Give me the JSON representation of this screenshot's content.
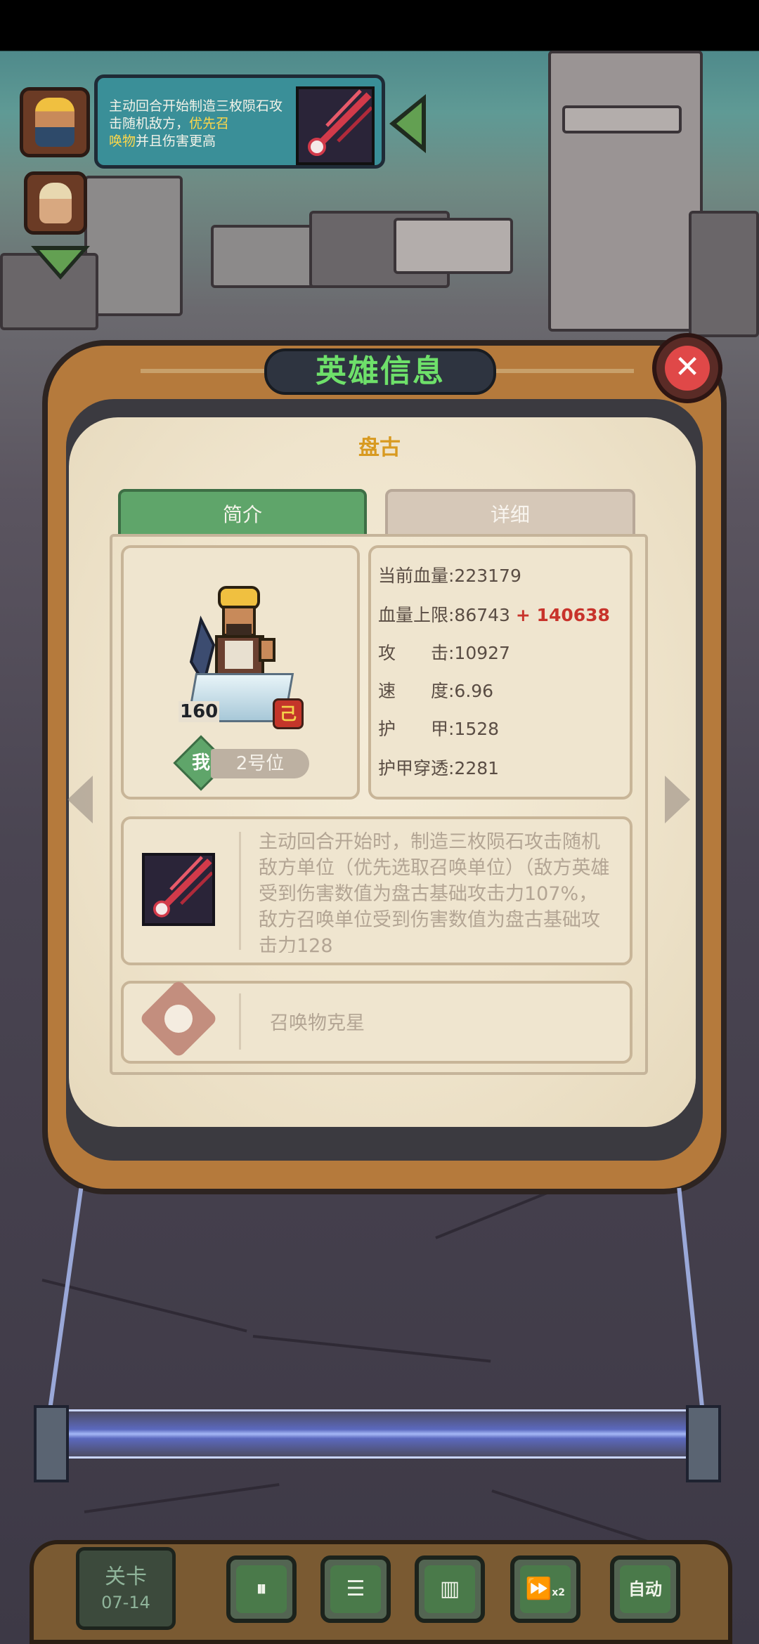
{
  "skill_banner": {
    "text_plain": "主动回合开始制造三枚陨石攻击随机敌方，",
    "text_highlight": "优先召",
    "text_tail_highlight": "唤物",
    "text_tail": "并且伤害更高"
  },
  "dialog": {
    "title": "英雄信息",
    "close_symbol": "✕"
  },
  "hero": {
    "name": "盘古",
    "level": "160",
    "rune_glyph": "己",
    "me_badge": "我",
    "position": "2号位"
  },
  "tabs": {
    "summary": "简介",
    "detail": "详细"
  },
  "stats": {
    "current_hp": "当前血量:223179",
    "max_hp": "血量上限:86743",
    "max_hp_bonus": "+ 140638",
    "attack": "攻　　击:10927",
    "speed": "速　　度:6.96",
    "armor": "护　　甲:1528",
    "armor_pen": "护甲穿透:2281"
  },
  "skill": {
    "description": "主动回合开始时，制造三枚陨石攻击随机敌方单位（优先选取召唤单位）（敌方英雄受到伤害数值为盘古基础攻击力107%，敌方召唤单位受到伤害数值为盘古基础攻击力128"
  },
  "trait": {
    "label": "召唤物克星"
  },
  "bottom_bar": {
    "stage_label": "关卡",
    "stage_value": "07-14",
    "pause_symbol": "⏸",
    "formation_symbol": "☰",
    "stats_symbol": "▥",
    "speed_symbol": "⏩",
    "speed_mult": "x2",
    "auto_label": "自动"
  },
  "colors": {
    "title_green": "#6ee06a",
    "hero_name_gold": "#d89a20",
    "bonus_red": "#c8332b",
    "tab_active": "#5fa56a",
    "frame_brown": "#b57a3c"
  },
  "icons": {
    "meteor": "meteor-skill-icon",
    "trait": "summon-counter-icon",
    "close": "close-icon",
    "prev": "chevron-left-icon",
    "next": "chevron-right-icon"
  }
}
